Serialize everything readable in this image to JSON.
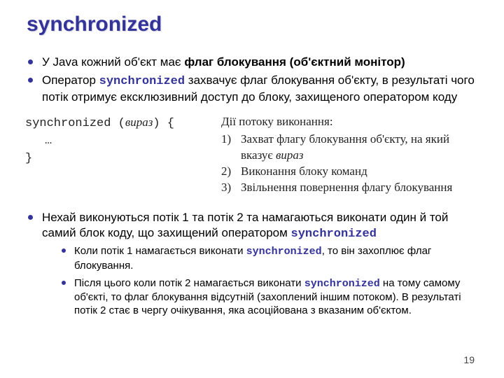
{
  "title": "synchronized",
  "keyword": "synchronized",
  "bullets": {
    "b1_pre": "У Java кожний об'єкт має ",
    "b1_bold": "флаг блокування (об'єктний монітор)",
    "b2_pre": "Оператор ",
    "b2_post": "  захвачує флаг блокування об'єкту, в результаті чого потік отримує ексклюзивний доступ до блоку, захищеного оператором коду",
    "b3_pre": "Нехай виконуються потік 1 та потік 2 та намагаються виконати один й той самий блок коду, що захищений оператором ",
    "s1_pre": "Коли потік 1 намагається виконати ",
    "s1_post": ", то він захоплює флаг блокування.",
    "s2_pre": "Після цього коли потік 2 намагається виконати ",
    "s2_post": " на тому самому об'єкті, то флаг блокування відсутній (захоплений іншим потоком). В результаті потік 2 стає в чергу очікування, яка асоційована з вказаним об'єктом."
  },
  "code": {
    "line1_kw": "synchronized",
    "line1_rest": " (",
    "line1_expr": "вираз",
    "line1_tail": ") {",
    "line2": "…",
    "line3": "}"
  },
  "exec": {
    "header": "Дії потоку виконання:",
    "items": [
      {
        "n": "1)",
        "text_a": "Захват флагу блокування об'єкту, на який вказує ",
        "text_i": "вираз"
      },
      {
        "n": "2)",
        "text_a": "Виконання блоку команд",
        "text_i": ""
      },
      {
        "n": "3)",
        "text_a": "Звільнення повернення флагу блокування",
        "text_i": ""
      }
    ]
  },
  "page_number": "19"
}
